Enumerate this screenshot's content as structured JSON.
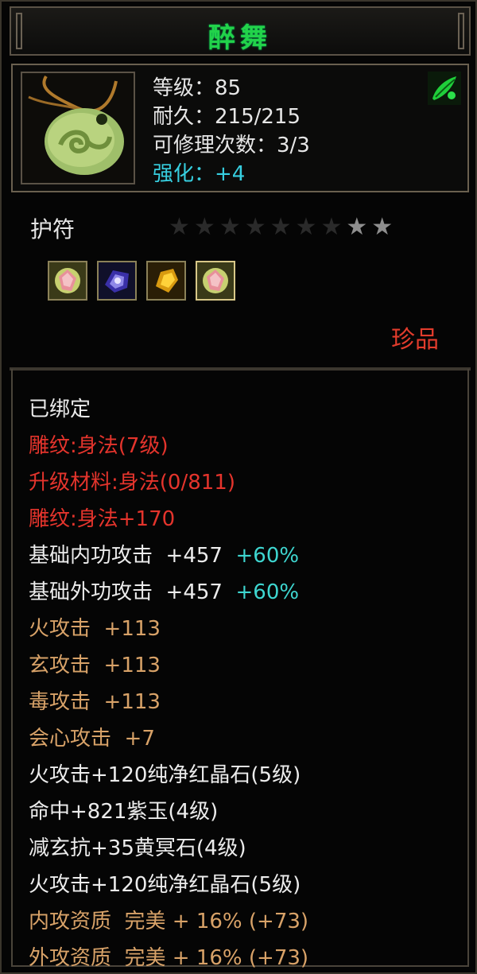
{
  "item": {
    "name": "醉舞",
    "stats": {
      "level": "等级：85",
      "durability": "耐久：215/215",
      "repairs": "可修理次数：3/3",
      "enhance_label": "强化：",
      "enhance_value": "+4"
    },
    "type": "护符",
    "stars": {
      "total": 9,
      "lit": 2
    },
    "gems": [
      "red-crystal-icon",
      "purple-jade-icon",
      "yellow-stone-icon",
      "red-crystal-icon"
    ],
    "rarity": "珍品"
  },
  "attributes": {
    "bound": "已绑定",
    "engrave": "雕纹:身法(7级)",
    "upgrade_material": "升级材料:身法(0/811)",
    "engrave_bonus": "雕纹:身法+170",
    "base_internal": "基础内功攻击",
    "base_internal_value": "+457",
    "base_internal_pct": "+60%",
    "base_external": "基础外功攻击",
    "base_external_value": "+457",
    "base_external_pct": "+60%",
    "fire_attack": "火攻击",
    "fire_attack_value": "+113",
    "mystic_attack": "玄攻击",
    "mystic_attack_value": "+113",
    "poison_attack": "毒攻击",
    "poison_attack_value": "+113",
    "crit_attack": "会心攻击",
    "crit_attack_value": "+7",
    "gem1": "火攻击+120纯净红晶石(5级)",
    "gem2": "命中+821紫玉(4级)",
    "gem3": "减玄抗+35黄冥石(4级)",
    "gem4": "火攻击+120纯净红晶石(5级)",
    "quality_internal": "内攻资质  完美 + 16% (+73)",
    "quality_external": "外攻资质  完美 + 16% (+73)"
  }
}
